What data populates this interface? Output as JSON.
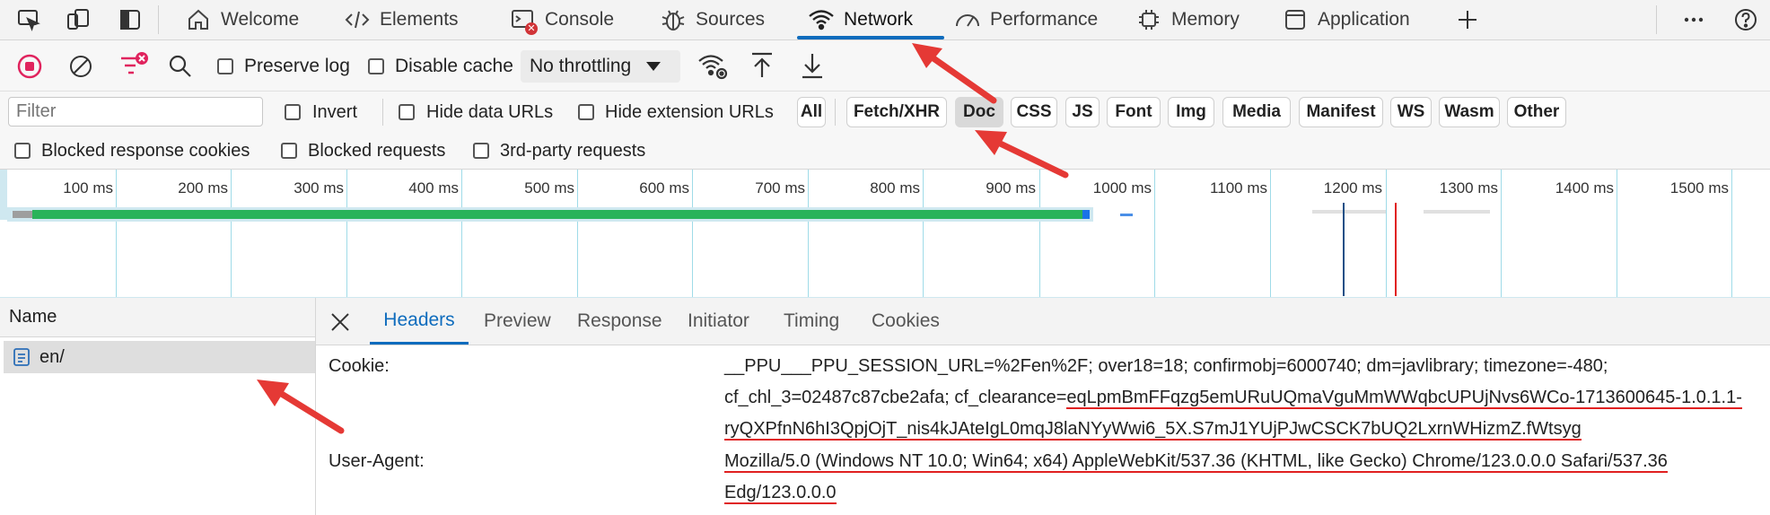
{
  "tabs": [
    {
      "label": "Welcome",
      "icon": "home-icon"
    },
    {
      "label": "Elements",
      "icon": "code-icon"
    },
    {
      "label": "Console",
      "icon": "console-icon"
    },
    {
      "label": "Sources",
      "icon": "bug-icon"
    },
    {
      "label": "Network",
      "icon": "wifi-icon",
      "active": true
    },
    {
      "label": "Performance",
      "icon": "gauge-icon"
    },
    {
      "label": "Memory",
      "icon": "chip-icon"
    },
    {
      "label": "Application",
      "icon": "app-icon"
    }
  ],
  "toolbar": {
    "preserve_log": "Preserve log",
    "disable_cache": "Disable cache",
    "throttling": "No throttling"
  },
  "filterbar": {
    "filter_placeholder": "Filter",
    "invert": "Invert",
    "hide_data_urls": "Hide data URLs",
    "hide_extension_urls": "Hide extension URLs",
    "type_pills": [
      "All",
      "Fetch/XHR",
      "Doc",
      "CSS",
      "JS",
      "Font",
      "Img",
      "Media",
      "Manifest",
      "WS",
      "Wasm",
      "Other"
    ],
    "selected_pill": "Doc",
    "blocked_response_cookies": "Blocked response cookies",
    "blocked_requests": "Blocked requests",
    "third_party": "3rd-party requests"
  },
  "timeline": {
    "ticks": [
      "100 ms",
      "200 ms",
      "300 ms",
      "400 ms",
      "500 ms",
      "600 ms",
      "700 ms",
      "800 ms",
      "900 ms",
      "1000 ms",
      "1100 ms",
      "1200 ms",
      "1300 ms",
      "1400 ms",
      "1500 ms"
    ]
  },
  "requests": {
    "column": "Name",
    "rows": [
      {
        "name": "en/"
      }
    ]
  },
  "details": {
    "tabs": [
      "Headers",
      "Preview",
      "Response",
      "Initiator",
      "Timing",
      "Cookies"
    ],
    "active_tab": "Headers",
    "headers": {
      "cookie_name": "Cookie:",
      "cookie_line1": "__PPU___PPU_SESSION_URL=%2Fen%2F; over18=18; confirmobj=6000740; dm=javlibrary; timezone=-480;",
      "cookie_line2a": "cf_chl_3=02487c87cbe2afa; cf_clearance=",
      "cookie_line2b": "eqLpmBmFFqzg5emURuUQmaVguMmWWqbcUPUjNvs6WCo-1713600645-1.0.1.1-",
      "cookie_line3": "ryQXPfnN6hI3QpjOjT_nis4kJAteIgL0mqJ8laNYyWwi6_5X.S7mJ1YUjPJwCSCK7bUQ2LxrnWHizmZ.fWtsyg",
      "ua_name": "User-Agent:",
      "ua_line1": "Mozilla/5.0 (Windows NT 10.0; Win64; x64) AppleWebKit/537.36 (KHTML, like Gecko) Chrome/123.0.0.0 Safari/537.36",
      "ua_line2": "Edg/123.0.0.0"
    }
  },
  "colors": {
    "accent": "#0f6cbd",
    "record": "#e0245e",
    "bar": "#29b35a",
    "annotation": "#e53935"
  }
}
